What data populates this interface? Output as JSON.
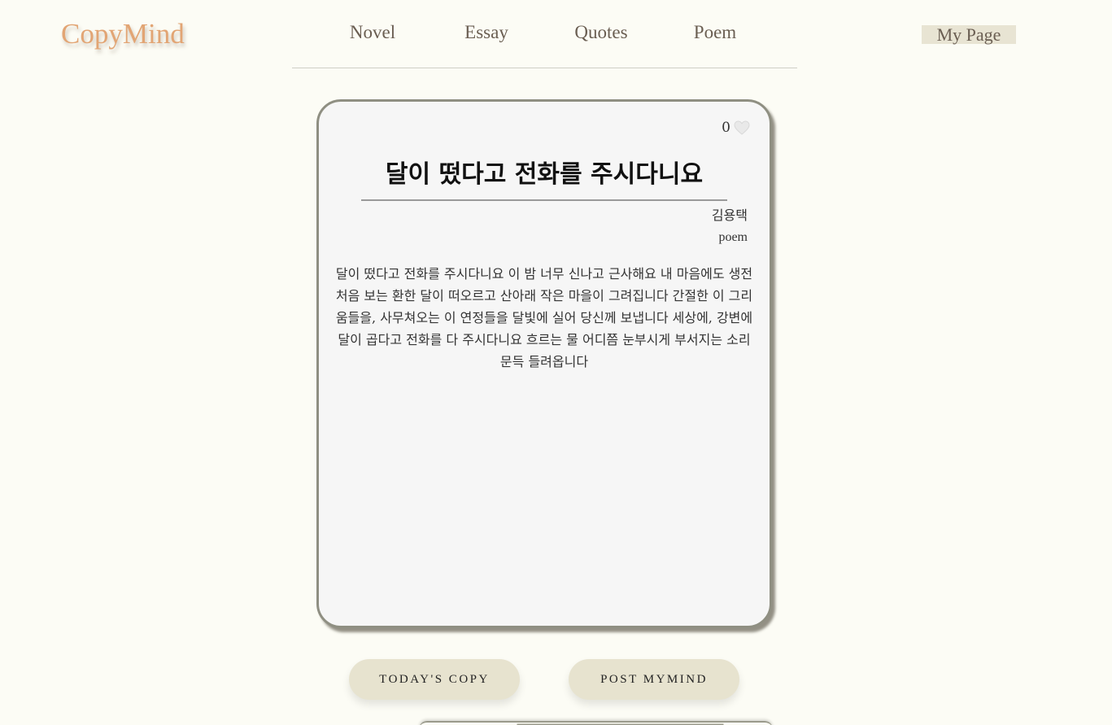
{
  "header": {
    "logo": "CopyMind",
    "nav": [
      {
        "label": "Novel"
      },
      {
        "label": "Essay"
      },
      {
        "label": "Quotes"
      },
      {
        "label": "Poem"
      }
    ],
    "mypage_label": "My Page"
  },
  "card": {
    "likes": "0",
    "title": "달이 떴다고 전화를 주시다니요",
    "author": "김용택",
    "category": "poem",
    "body": "달이 떴다고 전화를 주시다니요 이 밤 너무 신나고 근사해요 내 마음에도 생전 처음 보는 환한 달이 떠오르고 산아래 작은 마을이 그려집니다 간절한 이 그리움들을, 사무쳐오는 이 연정들을 달빛에 실어 당신께 보냅니다 세상에, 강변에 달이 곱다고 전화를 다 주시다니요 흐르는 물 어디쯤 눈부시게 부서지는 소리 문득 들려옵니다"
  },
  "buttons": {
    "today_copy": "TODAY'S COPY",
    "post_mymind": "POST MYMIND"
  },
  "colors": {
    "logo": "#e2a574",
    "background": "#fcfcf5",
    "card_bg": "#f6f6f6",
    "button_bg": "#e7e3cf",
    "mypage_bg": "#e8e4d3"
  },
  "icons": {
    "like": "heart-icon"
  }
}
